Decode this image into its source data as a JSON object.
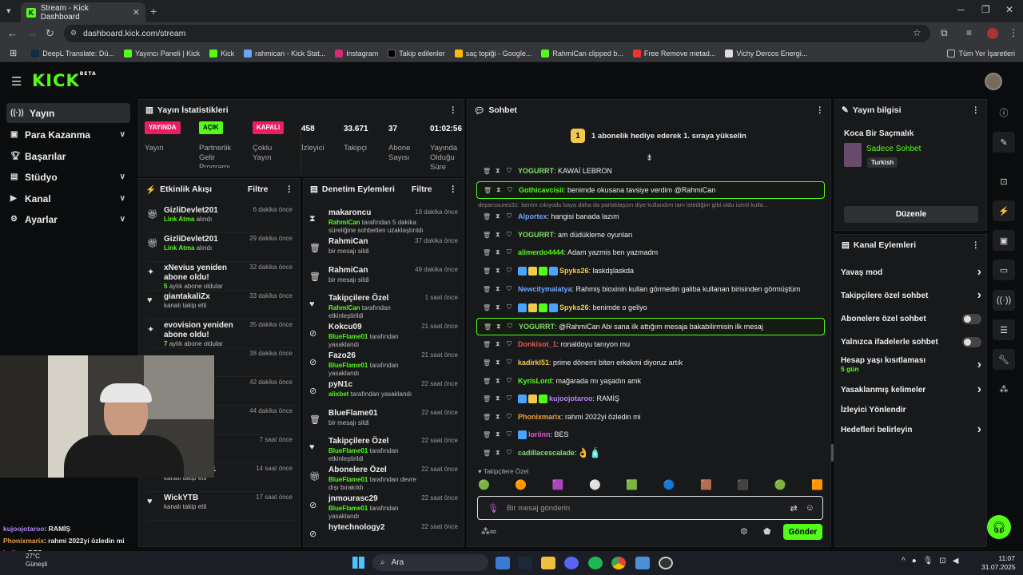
{
  "browser": {
    "tab_title": "Stream - Kick Dashboard",
    "url": "dashboard.kick.com/stream",
    "bookmarks": [
      "DeepL Translate: Dü...",
      "Yayıncı Paneli | Kick",
      "Kick",
      "rahmican - Kick Stat...",
      "Instagram",
      "Takip edilenler",
      "saç topiği - Google...",
      "RahmiCan clipped b...",
      "Free Remove metad...",
      "Vichy Dercos Energi..."
    ],
    "all_bookmarks": "Tüm Yer İşaretleri"
  },
  "app": {
    "logo": "KICK",
    "beta": "BETA"
  },
  "sidebar": {
    "items": [
      {
        "label": "Yayın"
      },
      {
        "label": "Para Kazanma"
      },
      {
        "label": "Başarılar"
      },
      {
        "label": "Stüdyo"
      },
      {
        "label": "Kanal"
      },
      {
        "label": "Ayarlar"
      }
    ]
  },
  "stats": {
    "title": "Yayın İstatistikleri",
    "badges": [
      {
        "badge": "YAYINDA",
        "label": "Yayın"
      },
      {
        "badge": "AÇIK",
        "label": "Partnerlik Gelir Programı"
      },
      {
        "badge": "KAPALI",
        "label": "Çoklu Yayın"
      }
    ],
    "values": [
      {
        "value": "458",
        "label": "İzleyici"
      },
      {
        "value": "33.671",
        "label": "Takipçi"
      },
      {
        "value": "37",
        "label": "Abone Sayısı"
      },
      {
        "value": "01:02:56",
        "label": "Yayında Olduğu Süre"
      }
    ]
  },
  "activity": {
    "title": "Etkinlik Akışı",
    "filter": "Filtre",
    "items": [
      {
        "title": "GizliDevlet201",
        "sub_hl": "Link Atma",
        "sub": "alındı",
        "time": "6 dakika önce"
      },
      {
        "title": "GizliDevlet201",
        "sub_hl": "Link Atma",
        "sub": "alındı",
        "time": "29 dakika önce"
      },
      {
        "title": "xNevius yeniden abone oldu!",
        "sub_hl": "5",
        "sub": "aylık abone oldular",
        "time": "32 dakika önce"
      },
      {
        "title": "giantakaliZx",
        "sub_hl": "",
        "sub": "kanalı takip etti",
        "time": "33 dakika önce"
      },
      {
        "title": "evovision yeniden abone oldu!",
        "sub_hl": "7",
        "sub": "aylık abone oldular",
        "time": "35 dakika önce"
      },
      {
        "title": "",
        "sub_hl": "",
        "sub": "",
        "time": "38 dakika önce"
      },
      {
        "title": "",
        "sub_hl": "",
        "sub": "",
        "time": "42 dakika önce"
      },
      {
        "title": "",
        "sub_hl": "",
        "sub": "",
        "time": "44 dakika önce"
      },
      {
        "title": "",
        "sub_hl": "",
        "sub": "",
        "time": "7 saat önce"
      },
      {
        "title": "Esataltuntas1",
        "sub_hl": "",
        "sub": "kanalı takip etti",
        "time": "14 saat önce"
      },
      {
        "title": "WickYTB",
        "sub_hl": "",
        "sub": "kanalı takip etti",
        "time": "17 saat önce"
      }
    ]
  },
  "moderation": {
    "title": "Denetim Eylemleri",
    "filter": "Filtre",
    "items": [
      {
        "title": "makaroncu",
        "sub_hl": "RahmiCan",
        "sub": "tarafından 5 dakika süreliğine sohbetten uzaklaştırıldı",
        "time": "19 dakika önce"
      },
      {
        "title": "RahmiCan",
        "sub_hl": "",
        "sub": "bir mesajı sildi",
        "time": "37 dakika önce"
      },
      {
        "title": "RahmiCan",
        "sub_hl": "",
        "sub": "bir mesajı sildi",
        "time": "49 dakika önce"
      },
      {
        "title": "Takipçilere Özel",
        "sub_hl": "RahmiCan",
        "sub": "tarafından etkinleştirildi",
        "time": "1 saat önce"
      },
      {
        "title": "Kokcu09",
        "sub_hl": "BlueFlame01",
        "sub": "tarafından yasaklandı",
        "time": "21 saat önce"
      },
      {
        "title": "Fazo26",
        "sub_hl": "BlueFlame01",
        "sub": "tarafından yasaklandı",
        "time": "21 saat önce"
      },
      {
        "title": "pyN1c",
        "sub_hl": "alixbet",
        "sub": "tarafından yasaklandı",
        "time": "22 saat önce"
      },
      {
        "title": "BlueFlame01",
        "sub_hl": "",
        "sub": "bir mesajı sildi",
        "time": "22 saat önce"
      },
      {
        "title": "Takipçilere Özel",
        "sub_hl": "BlueFlame01",
        "sub": "tarafından etkinleştirildi",
        "time": "22 saat önce"
      },
      {
        "title": "Abonelere Özel",
        "sub_hl": "BlueFlame01",
        "sub": "tarafından devre dışı bırakıldı",
        "time": "22 saat önce"
      },
      {
        "title": "jnmourasc29",
        "sub_hl": "BlueFlame01",
        "sub": "tarafından yasaklandı",
        "time": "22 saat önce"
      },
      {
        "title": "hytechnology2",
        "sub_hl": "",
        "sub": "",
        "time": "22 saat önce"
      }
    ]
  },
  "chat": {
    "title": "Sohbet",
    "banner": "1 abonelik hediye ederek 1. sıraya yükselin",
    "rank": "1",
    "messages": [
      {
        "user": "YOGURRT",
        "color": "#7fe06b",
        "text": ": KAWAİ LEBRON",
        "hl": false,
        "badges": 0
      },
      {
        "user": "Gothicavcisii",
        "color": "#53fc18",
        "text": ": benimde okusana tavsiye verdim @RahmiCan",
        "hl": true,
        "badges": 0
      },
      {
        "user": "Alportex",
        "color": "#6aa6ff",
        "text": ": hangisi banada lazım",
        "hl": false,
        "badges": 0
      },
      {
        "user": "YOGURRT",
        "color": "#7fe06b",
        "text": ": am düdükleme oyunları",
        "hl": false,
        "badges": 0
      },
      {
        "user": "alimerdo4444",
        "color": "#53fc18",
        "text": ": Adam yazmis ben yazmadm",
        "hl": false,
        "badges": 0
      },
      {
        "user": "Spyks26",
        "color": "#f2c94c",
        "text": ": laskdşlaskda",
        "hl": false,
        "badges": 4
      },
      {
        "user": "Newcitymalatya",
        "color": "#6aa6ff",
        "text": ": Rahmiş bioxinin kullan görmedin galiba kullanan birisinden görmüştüm",
        "hl": false,
        "badges": 0
      },
      {
        "user": "Spyks26",
        "color": "#f2c94c",
        "text": ": benimde o geliyo",
        "hl": false,
        "badges": 4
      },
      {
        "user": "YOGURRT",
        "color": "#7fe06b",
        "text": ": @RahmiCan Abi sana ilk attığım mesaja bakabilirmisin ilk mesaj",
        "hl": true,
        "badges": 0
      },
      {
        "user": "Donkisot_1",
        "color": "#e05a5a",
        "text": ": ronaldoyu tanıyon mu",
        "hl": false,
        "badges": 0
      },
      {
        "user": "kadirkl51",
        "color": "#f2c94c",
        "text": ": prime dönemi biten erkekmi diyoruz artık",
        "hl": false,
        "badges": 0
      },
      {
        "user": "KyrisLord",
        "color": "#53fc18",
        "text": ": mağarada mı yaşadın amk",
        "hl": false,
        "badges": 0
      },
      {
        "user": "kujoojotaroo",
        "color": "#b084f5",
        "text": ": RAMİŞ",
        "hl": false,
        "badges": 3
      },
      {
        "user": "Phonixmarix",
        "color": "#f0a040",
        "text": ": rahmi 2022yi özledin mi",
        "hl": false,
        "badges": 0
      },
      {
        "user": "loriinn",
        "color": "#e05ad0",
        "text": ": BES",
        "hl": false,
        "badges": 1
      },
      {
        "user": "cadillacescalade",
        "color": "#7fe06b",
        "text": ":",
        "hl": false,
        "badges": 0
      }
    ],
    "reply_preview": "deparsaures31: benim cıkıyodu baya daha da parlaklaşsın diye kullandım tam istediğim gibi oldu isimli kulla...",
    "followers_only": "Takipçilere Özel",
    "input_placeholder": "Bir mesaj gönderin",
    "send": "Gönder"
  },
  "stream_info": {
    "title": "Yayın bilgisi",
    "stream_title": "Koca Bir Saçmalık",
    "category": "Sadece Sohbet",
    "language": "Turkish",
    "edit": "Düzenle"
  },
  "channel_actions": {
    "title": "Kanal Eylemleri",
    "items": [
      {
        "label": "Yavaş mod",
        "control": "chevron",
        "sub": ""
      },
      {
        "label": "Takipçilere özel sohbet",
        "control": "chevron",
        "sub": ""
      },
      {
        "label": "Abonelere özel sohbet",
        "control": "toggle",
        "sub": ""
      },
      {
        "label": "Yalnızca ifadelerle sohbet",
        "control": "toggle",
        "sub": ""
      },
      {
        "label": "Hesap yaşı kısıtlaması",
        "control": "chevron",
        "sub": "5 gün"
      },
      {
        "label": "Yasaklanmış kelimeler",
        "control": "chevron",
        "sub": ""
      },
      {
        "label": "İzleyici Yönlendir",
        "control": "none",
        "sub": ""
      },
      {
        "label": "Hedefleri belirleyin",
        "control": "chevron",
        "sub": ""
      }
    ]
  },
  "overlay_chat": [
    {
      "user": "kujoojotaroo",
      "text": ": RAMİŞ"
    },
    {
      "user": "Phonixmarix",
      "text": ": rahmi 2022yi özledin mi"
    },
    {
      "user": "loriinn",
      "text": ": BES"
    }
  ],
  "taskbar": {
    "search": "Ara",
    "time": "11:07",
    "date": "31.07.2025",
    "weather": "27°C",
    "weather_sub": "Güneşli"
  },
  "colors": {
    "accent": "#53fc18",
    "live": "#e91e63",
    "bg": "#0b0c0d",
    "panel": "#18191b"
  }
}
